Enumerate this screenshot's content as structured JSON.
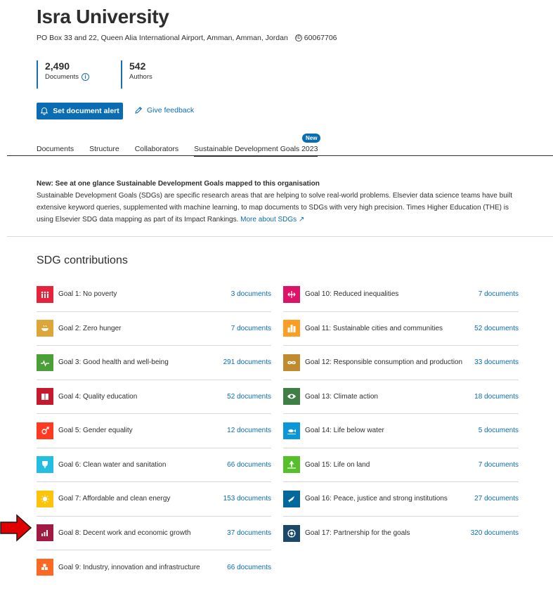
{
  "org": {
    "name": "Isra University",
    "address": "PO Box 33 and 22, Queen Alia International Airport, Amman, Amman, Jordan",
    "id": "60067706"
  },
  "metrics": {
    "documents_value": "2,490",
    "documents_label": "Documents",
    "authors_value": "542",
    "authors_label": "Authors"
  },
  "actions": {
    "alert_label": "Set document alert",
    "feedback_label": "Give feedback"
  },
  "tabs": [
    {
      "label": "Documents"
    },
    {
      "label": "Structure"
    },
    {
      "label": "Collaborators"
    },
    {
      "label": "Sustainable Development Goals 2023"
    }
  ],
  "new_badge": "New",
  "notice": {
    "heading": "New: See at one glance Sustainable Development Goals mapped to this organisation",
    "body": "Sustainable Development Goals (SDGs) are specific research areas that are helping to solve real-world problems. Elsevier data science teams have built extensive keyword queries, supplemented with machine learning, to map documents to SDGs with very high precision. Times Higher Education (THE) is using Elsevier SDG data mapping as part of its Impact Rankings.",
    "link": "More about SDGs"
  },
  "sdg": {
    "title": "SDG contributions",
    "left": [
      {
        "label": "Goal 1: No poverty",
        "count": "3 documents",
        "color": "#e5243b",
        "icon": "people-icon"
      },
      {
        "label": "Goal 2: Zero hunger",
        "count": "7 documents",
        "color": "#dda63a",
        "icon": "bowl-icon"
      },
      {
        "label": "Goal 3: Good health and well-being",
        "count": "291 documents",
        "color": "#4c9f38",
        "icon": "heartbeat-icon"
      },
      {
        "label": "Goal 4: Quality education",
        "count": "52 documents",
        "color": "#c5192d",
        "icon": "book-icon"
      },
      {
        "label": "Goal 5: Gender equality",
        "count": "12 documents",
        "color": "#ff3a21",
        "icon": "gender-icon"
      },
      {
        "label": "Goal 6: Clean water and sanitation",
        "count": "66 documents",
        "color": "#26bde2",
        "icon": "water-icon"
      },
      {
        "label": "Goal 7: Affordable and clean energy",
        "count": "153 documents",
        "color": "#fcc30b",
        "icon": "sun-icon"
      },
      {
        "label": "Goal 8: Decent work and economic growth",
        "count": "37 documents",
        "color": "#a21942",
        "icon": "growth-icon"
      },
      {
        "label": "Goal 9: Industry, innovation and infrastructure",
        "count": "66 documents",
        "color": "#fd6925",
        "icon": "cubes-icon"
      }
    ],
    "right": [
      {
        "label": "Goal 10: Reduced inequalities",
        "count": "7 documents",
        "color": "#dd1367",
        "icon": "equality-icon"
      },
      {
        "label": "Goal 11: Sustainable cities and communities",
        "count": "52 documents",
        "color": "#fd9d24",
        "icon": "city-icon"
      },
      {
        "label": "Goal 12: Responsible consumption and production",
        "count": "33 documents",
        "color": "#bf8b2e",
        "icon": "infinity-icon"
      },
      {
        "label": "Goal 13: Climate action",
        "count": "18 documents",
        "color": "#3f7e44",
        "icon": "eye-icon"
      },
      {
        "label": "Goal 14: Life below water",
        "count": "5 documents",
        "color": "#0a97d9",
        "icon": "fish-icon"
      },
      {
        "label": "Goal 15: Life on land",
        "count": "7 documents",
        "color": "#56c02b",
        "icon": "tree-icon"
      },
      {
        "label": "Goal 16: Peace, justice and strong institutions",
        "count": "27 documents",
        "color": "#00689d",
        "icon": "dove-icon"
      },
      {
        "label": "Goal 17: Partnership for the goals",
        "count": "320 documents",
        "color": "#19486a",
        "icon": "partnership-icon"
      }
    ]
  }
}
